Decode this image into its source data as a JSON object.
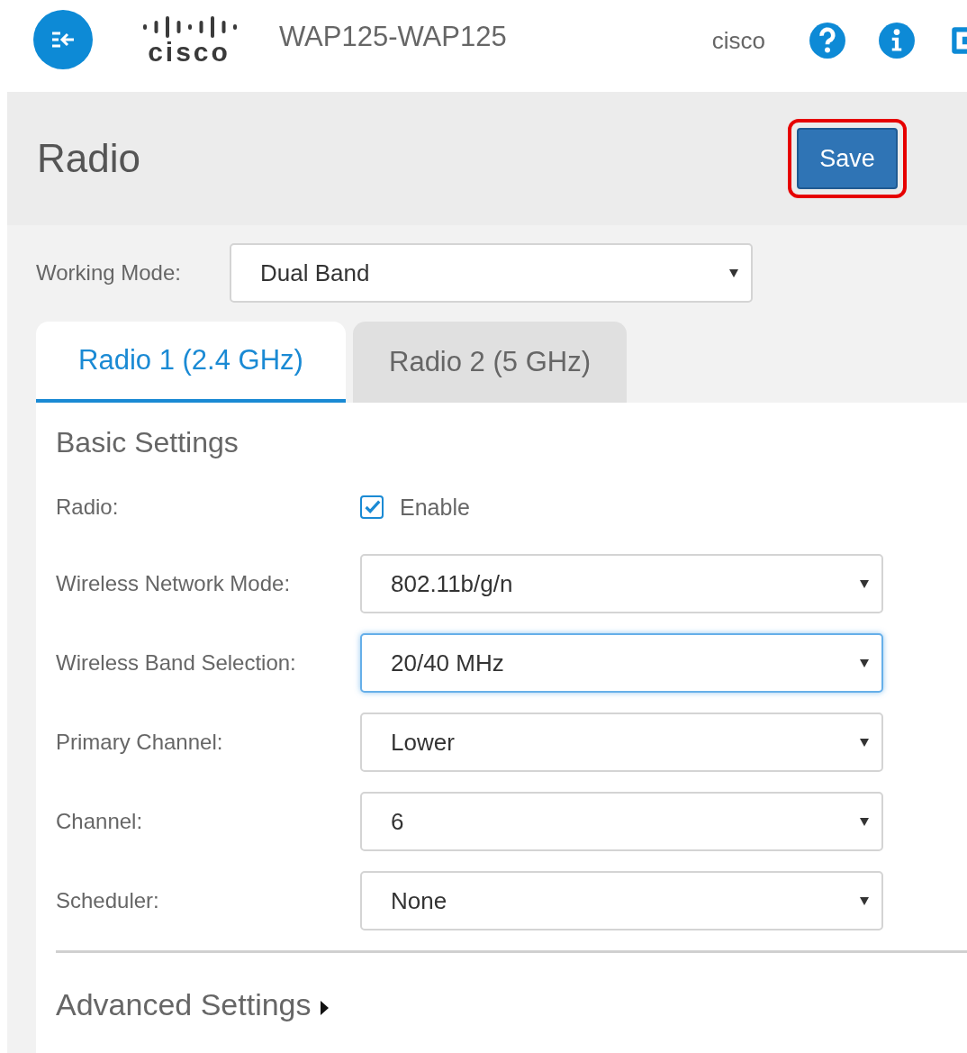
{
  "header": {
    "logo_text": "cisco",
    "device_name": "WAP125-WAP125",
    "user": "cisco"
  },
  "page": {
    "title": "Radio",
    "save_button": {
      "label": "Save",
      "highlighted": true
    }
  },
  "working_mode": {
    "label": "Working Mode:",
    "value": "Dual Band"
  },
  "tabs": [
    {
      "label": "Radio 1 (2.4 GHz)",
      "selected": true
    },
    {
      "label": "Radio 2 (5 GHz)",
      "selected": false
    }
  ],
  "basic_settings": {
    "title": "Basic Settings",
    "fields": [
      {
        "kind": "checkbox",
        "label": "Radio:",
        "option": "Enable",
        "checked": true
      },
      {
        "kind": "select",
        "label": "Wireless Network Mode:",
        "value": "802.11b/g/n",
        "focused": false
      },
      {
        "kind": "select",
        "label": "Wireless Band Selection:",
        "value": "20/40 MHz",
        "focused": true
      },
      {
        "kind": "select",
        "label": "Primary Channel:",
        "value": "Lower",
        "focused": false
      },
      {
        "kind": "select",
        "label": "Channel:",
        "value": "6",
        "focused": false
      },
      {
        "kind": "select",
        "label": "Scheduler:",
        "value": "None",
        "focused": false
      }
    ]
  },
  "advanced_settings": {
    "title": "Advanced Settings",
    "expanded": false
  }
}
